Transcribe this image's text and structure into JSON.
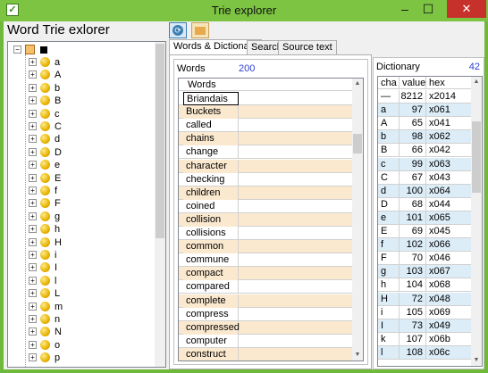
{
  "window": {
    "title": "Trie explorer",
    "close_glyph": "✕",
    "minimize_glyph": "–",
    "maximize_glyph": "☐",
    "app_icon_glyph": "✓"
  },
  "left_panel": {
    "title": "Word Trie exlorer",
    "tree_items": [
      "a",
      "A",
      "b",
      "B",
      "c",
      "C",
      "d",
      "D",
      "e",
      "E",
      "f",
      "F",
      "g",
      "h",
      "H",
      "i",
      "I",
      "l",
      "L",
      "m",
      "n",
      "N",
      "o",
      "p"
    ]
  },
  "toolbar": {
    "icon1": "refresh-icon",
    "icon2": "folder-icon"
  },
  "tabs": [
    "Words & Dictionary",
    "Search",
    "Source text"
  ],
  "words": {
    "label": "Words",
    "count": "200",
    "column_header": "Words",
    "items": [
      "Briandais",
      "Buckets",
      "called",
      "chains",
      "change",
      "character",
      "checking",
      "children",
      "coined",
      "collision",
      "collisions",
      "common",
      "commune",
      "compact",
      "compared",
      "complete",
      "compress",
      "compressed",
      "computer",
      "construct"
    ]
  },
  "dictionary": {
    "label": "Dictionary",
    "count": "42",
    "headers": [
      "cha",
      "value",
      "hex"
    ],
    "rows": [
      [
        "—",
        "8212",
        "x2014"
      ],
      [
        "a",
        "97",
        "x061"
      ],
      [
        "A",
        "65",
        "x041"
      ],
      [
        "b",
        "98",
        "x062"
      ],
      [
        "B",
        "66",
        "x042"
      ],
      [
        "c",
        "99",
        "x063"
      ],
      [
        "C",
        "67",
        "x043"
      ],
      [
        "d",
        "100",
        "x064"
      ],
      [
        "D",
        "68",
        "x044"
      ],
      [
        "e",
        "101",
        "x065"
      ],
      [
        "E",
        "69",
        "x045"
      ],
      [
        "f",
        "102",
        "x066"
      ],
      [
        "F",
        "70",
        "x046"
      ],
      [
        "g",
        "103",
        "x067"
      ],
      [
        "h",
        "104",
        "x068"
      ],
      [
        "H",
        "72",
        "x048"
      ],
      [
        "i",
        "105",
        "x069"
      ],
      [
        "I",
        "73",
        "x049"
      ],
      [
        "k",
        "107",
        "x06b"
      ],
      [
        "l",
        "108",
        "x06c"
      ]
    ]
  }
}
